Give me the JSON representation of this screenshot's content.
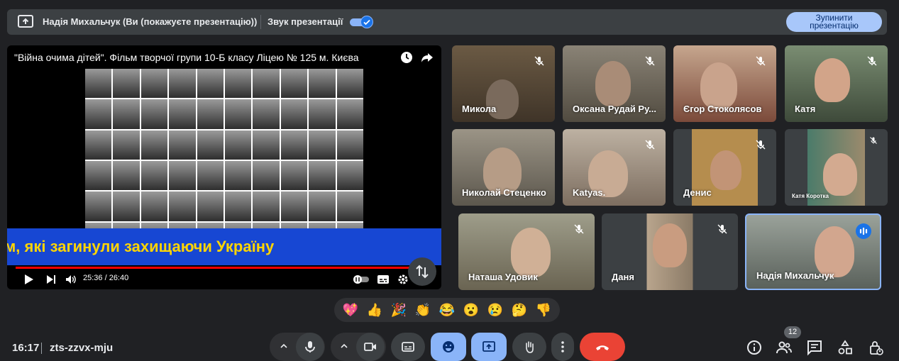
{
  "presenting_bar": {
    "presenter_text": "Надія Михальчук (Ви (покажуєте презентацію))",
    "sound_label": "Звук презентації",
    "sound_enabled": true,
    "stop_button_label": "Зупинити презентацію"
  },
  "video": {
    "title": "\"Війна очима дітей\". Фільм творчої групи 10-Б класу Ліцею № 125 м. Києва",
    "banner_text": "м, які загинули захищаючи Україну",
    "time": "25:36 / 26:40",
    "progress": 0.96,
    "icons": [
      "watch-later-icon",
      "share-icon",
      "play-icon",
      "skip-next-icon",
      "volume-icon",
      "autoplay-toggle-icon",
      "subtitles-icon",
      "settings-icon",
      "swap-icon"
    ]
  },
  "participants": [
    {
      "name": "Микола",
      "muted": true
    },
    {
      "name": "Оксана Рудай Ру...",
      "muted": true
    },
    {
      "name": "Єгор Стоколясов",
      "muted": true
    },
    {
      "name": "Катя",
      "muted": true
    },
    {
      "name": "Николай Стеценко",
      "muted": false
    },
    {
      "name": "Katyas.",
      "muted": true
    },
    {
      "name": "Денис",
      "muted": true
    },
    {
      "name": "Катя Коротка",
      "muted": true
    },
    {
      "name": "Наташа Удовик",
      "muted": true
    },
    {
      "name": "Даня",
      "muted": true
    },
    {
      "name": "Надія Михальчук",
      "muted": false,
      "speaking": true
    }
  ],
  "reactions": [
    "💖",
    "👍",
    "🎉",
    "👏",
    "😂",
    "😮",
    "😢",
    "🤔",
    "👎"
  ],
  "bottom_bar": {
    "time": "16:17",
    "meeting_code": "zts-zzvx-mju",
    "participants_count": "12"
  },
  "colors": {
    "background": "#202124",
    "accent_blue": "#8ab4f8",
    "end_call_red": "#ea4335",
    "banner_blue": "#1747d3",
    "banner_text": "#ffd500"
  }
}
